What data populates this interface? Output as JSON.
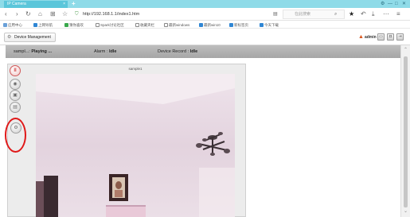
{
  "browser": {
    "tab_title": "IP Camera",
    "url": "http://192.168.1.1/index1.htm",
    "search_placeholder": "在此搜索",
    "bookmarks": [
      "应用中心",
      "上网导航",
      "猜你喜欢",
      "Spark讨论社区",
      "收藏夹栏",
      "最新windows",
      "最新win10",
      "新标签页",
      "今天下载"
    ]
  },
  "app": {
    "device_tab": "Device Management",
    "user": "admin"
  },
  "status": {
    "channel_label": "sampl...:",
    "channel_state": "Playing ...",
    "alarm_label": "Alarm :",
    "alarm_state": "Idle",
    "record_label": "Device Record :",
    "record_state": "Idle"
  },
  "video": {
    "title": "sample1"
  },
  "tools": [
    {
      "name": "pause",
      "icon": "pause-icon"
    },
    {
      "name": "snapshot",
      "icon": "camera-icon"
    },
    {
      "name": "record",
      "icon": "record-icon"
    },
    {
      "name": "playback",
      "icon": "playback-icon"
    },
    {
      "name": "settings",
      "icon": "gear-icon"
    }
  ],
  "colors": {
    "annotation": "#e01818",
    "titlebar": "#8fdbe8",
    "status_bar": "#b1b1b1"
  }
}
